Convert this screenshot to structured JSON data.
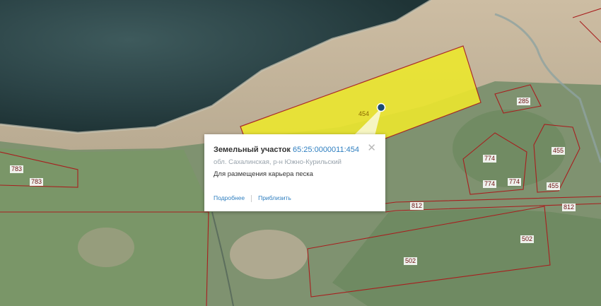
{
  "map": {
    "parcel_labels": [
      "454",
      "783",
      "783",
      "285",
      "774",
      "774",
      "774",
      "455",
      "455",
      "812",
      "812",
      "502",
      "502"
    ],
    "selected_parcel_color": "#ece72e",
    "boundary_color": "#a81e1e"
  },
  "popup": {
    "title": "Земельный участок",
    "cadastral_number": "65:25:0000011:454",
    "address": "обл. Сахалинская, р-н Южно-Курильский",
    "description": "Для размещения карьера песка",
    "more_link": "Подробнее",
    "zoom_link": "Приблизить"
  }
}
